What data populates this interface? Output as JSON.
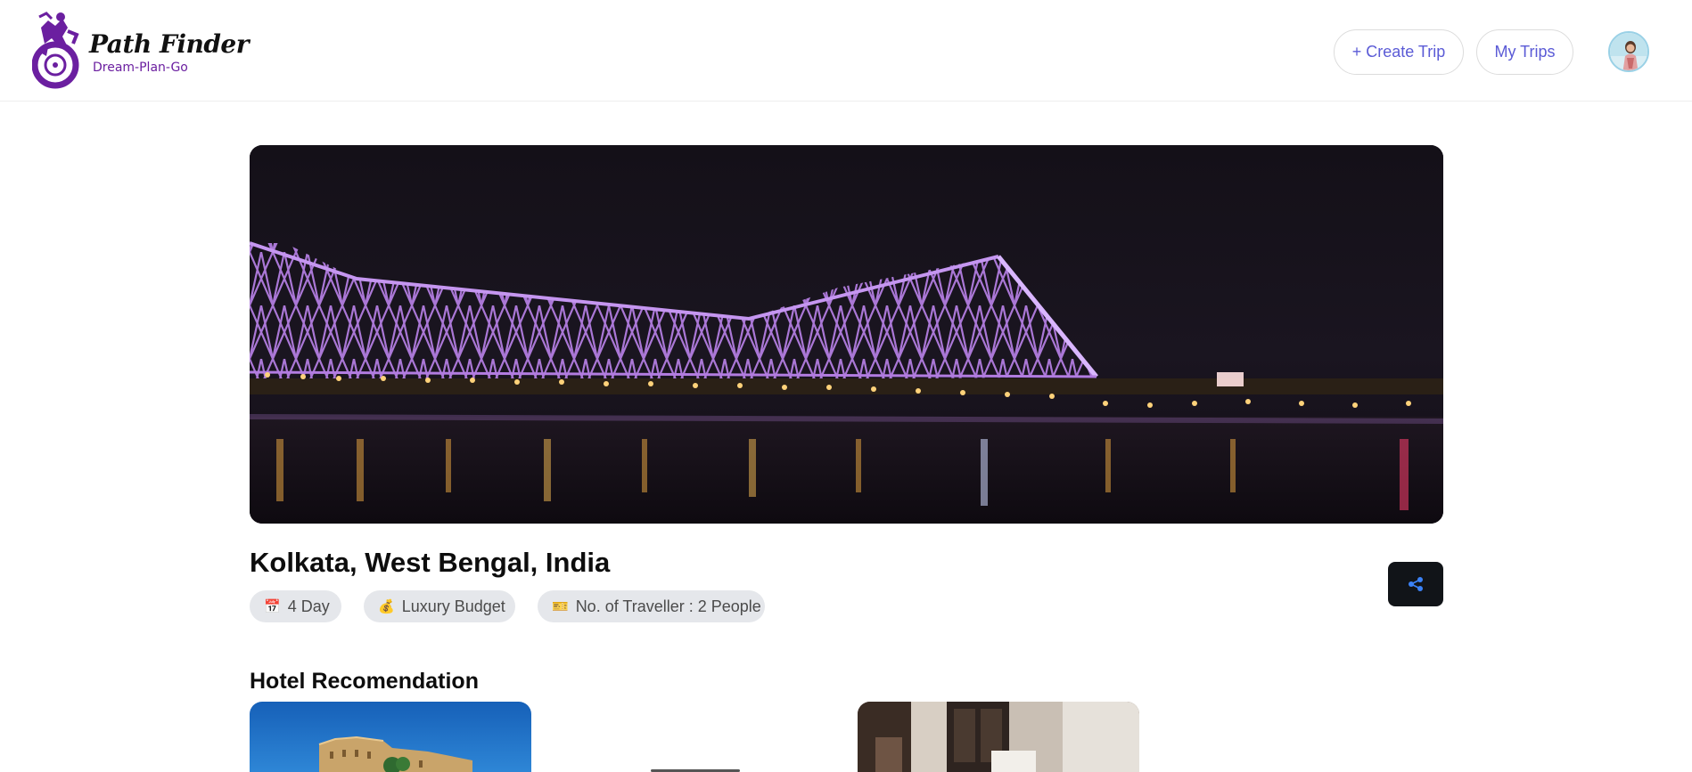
{
  "brand": {
    "name": "Path Finder",
    "tagline": "Dream-Plan-Go",
    "color": "#6b1fa0"
  },
  "nav": {
    "create_trip": "+ Create Trip",
    "my_trips": "My Trips",
    "avatar_icon": "user-avatar",
    "accent": "#5b5bd6"
  },
  "trip": {
    "hero_icon": "howrah-bridge-night-photo",
    "location": "Kolkata, West Bengal, India",
    "chips": [
      {
        "icon": "calendar-icon",
        "glyph": "📅",
        "label": "4 Day"
      },
      {
        "icon": "money-bag-icon",
        "glyph": "💰",
        "label": "Luxury Budget"
      },
      {
        "icon": "ticket-icon",
        "glyph": "🎫",
        "label": "No. of Traveller : 2 People"
      }
    ],
    "share_icon": "share-icon"
  },
  "hotels": {
    "title": "Hotel Recomendation",
    "cards": [
      {
        "icon": "hotel-photo-palace"
      },
      {
        "icon": "hotel-photo-room"
      }
    ]
  }
}
